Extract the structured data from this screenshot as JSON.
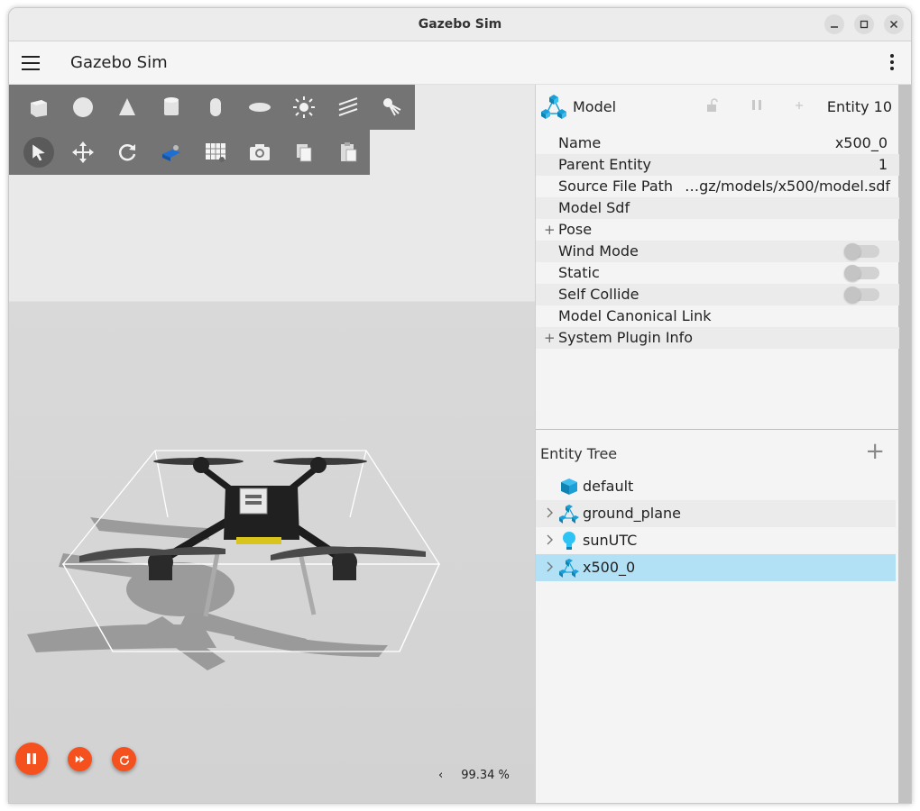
{
  "window": {
    "title": "Gazebo Sim"
  },
  "appbar": {
    "title": "Gazebo Sim"
  },
  "viewport": {
    "rtf_value": "99.34 %",
    "rtf_arrow": "‹"
  },
  "component_inspector": {
    "type_label": "Model",
    "entity_label": "Entity 10",
    "rows": [
      {
        "key": "Name",
        "value": "x500_0"
      },
      {
        "key": "Parent Entity",
        "value": "1"
      },
      {
        "key": "Source File Path",
        "value": "…gz/models/x500/model.sdf"
      },
      {
        "key": "Model Sdf",
        "value": ""
      },
      {
        "key": "Pose",
        "value": ""
      },
      {
        "key": "Wind Mode",
        "value": ""
      },
      {
        "key": "Static",
        "value": ""
      },
      {
        "key": "Self Collide",
        "value": ""
      },
      {
        "key": "Model Canonical Link",
        "value": ""
      },
      {
        "key": "System Plugin Info",
        "value": ""
      }
    ]
  },
  "entity_tree": {
    "title": "Entity Tree",
    "items": [
      {
        "name": "default"
      },
      {
        "name": "ground_plane"
      },
      {
        "name": "sunUTC"
      },
      {
        "name": "x500_0"
      }
    ]
  },
  "colors": {
    "accent_orange": "#f4511e",
    "selection_blue": "#b2e0f4",
    "toolbar_gray": "#747474",
    "model_icon_blue": "#1aa0d8"
  }
}
